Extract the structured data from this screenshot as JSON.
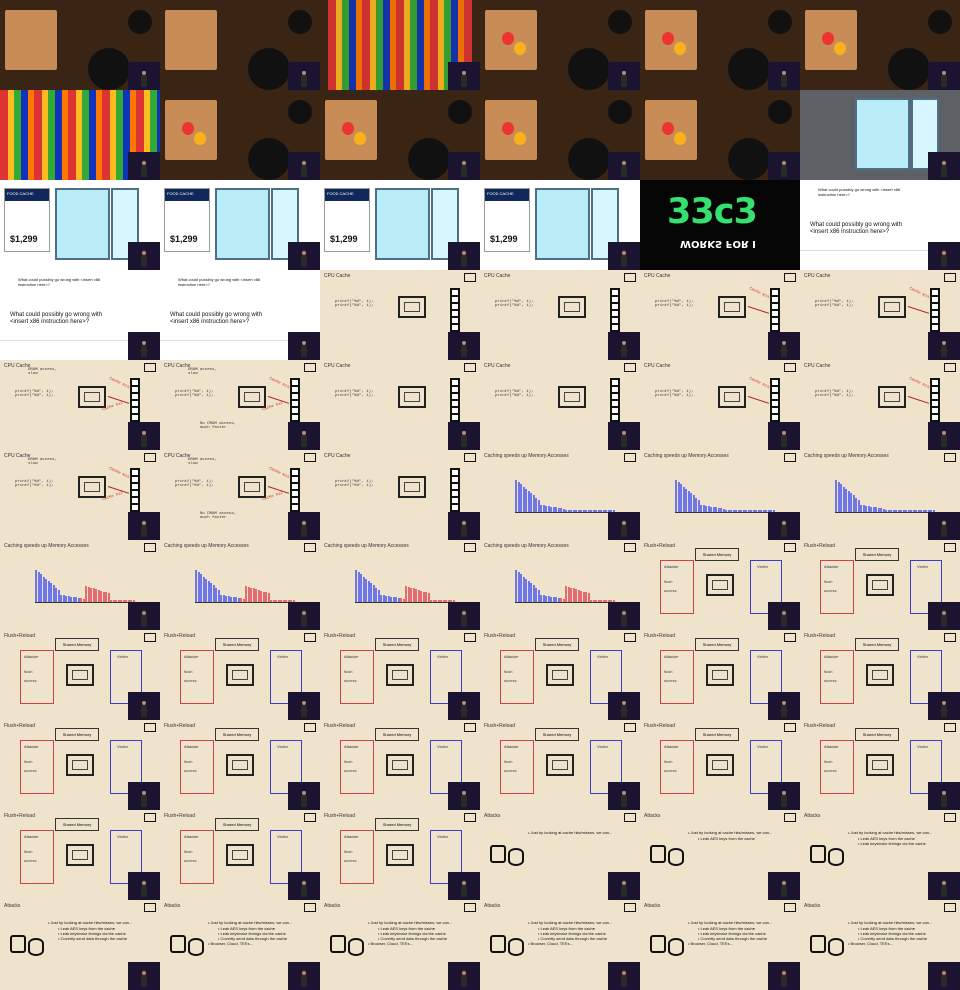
{
  "grid": {
    "columns": 6,
    "rows": 11,
    "frames": [
      {
        "kind": "kitchen",
        "title": ""
      },
      {
        "kind": "kitchen",
        "title": ""
      },
      {
        "kind": "market",
        "title": ""
      },
      {
        "kind": "kitchen",
        "title": ""
      },
      {
        "kind": "kitchen",
        "title": ""
      },
      {
        "kind": "kitchen",
        "title": ""
      },
      {
        "kind": "shelves",
        "title": ""
      },
      {
        "kind": "kitchen",
        "title": ""
      },
      {
        "kind": "kitchen",
        "title": ""
      },
      {
        "kind": "kitchen",
        "title": ""
      },
      {
        "kind": "kitchen",
        "title": ""
      },
      {
        "kind": "fridge",
        "title": ""
      },
      {
        "kind": "fridge_price",
        "title": "FOOD CACHE",
        "price": "$1,299"
      },
      {
        "kind": "fridge_price",
        "title": "FOOD CACHE",
        "price": "$1,299"
      },
      {
        "kind": "fridge_price",
        "title": "FOOD CACHE",
        "price": "$1,299"
      },
      {
        "kind": "fridge_price",
        "title": "FOOD CACHE",
        "price": "$1,299"
      },
      {
        "kind": "congress",
        "title": "33c3",
        "subtitle": "WORKS FOR I"
      },
      {
        "kind": "talk_title",
        "title": "What could possibly go wrong with <insert x86 instruction here>?"
      },
      {
        "kind": "talk_title",
        "title": "What could possibly go wrong with <insert x86 instruction here>?"
      },
      {
        "kind": "talk_title",
        "title": "What could possibly go wrong with <insert x86 instruction here>?"
      },
      {
        "kind": "cache",
        "title": "CPU Cache"
      },
      {
        "kind": "cache",
        "title": "CPU Cache"
      },
      {
        "kind": "cache",
        "title": "CPU Cache"
      },
      {
        "kind": "cache",
        "title": "CPU Cache"
      },
      {
        "kind": "cache",
        "title": "CPU Cache"
      },
      {
        "kind": "cache",
        "title": "CPU Cache"
      },
      {
        "kind": "cache",
        "title": "CPU Cache"
      },
      {
        "kind": "cache",
        "title": "CPU Cache"
      },
      {
        "kind": "cache",
        "title": "CPU Cache"
      },
      {
        "kind": "cache",
        "title": "CPU Cache"
      },
      {
        "kind": "cache",
        "title": "CPU Cache"
      },
      {
        "kind": "cache",
        "title": "CPU Cache"
      },
      {
        "kind": "cache",
        "title": "CPU Cache"
      },
      {
        "kind": "hist",
        "title": "Caching speeds up Memory Accesses"
      },
      {
        "kind": "hist",
        "title": "Caching speeds up Memory Accesses"
      },
      {
        "kind": "hist",
        "title": "Caching speeds up Memory Accesses"
      },
      {
        "kind": "hist2",
        "title": "Caching speeds up Memory Accesses"
      },
      {
        "kind": "hist2",
        "title": "Caching speeds up Memory Accesses"
      },
      {
        "kind": "hist2",
        "title": "Caching speeds up Memory Accesses"
      },
      {
        "kind": "hist2",
        "title": "Caching speeds up Memory Accesses"
      },
      {
        "kind": "flush",
        "title": "Flush+Reload"
      },
      {
        "kind": "flush",
        "title": "Flush+Reload"
      },
      {
        "kind": "flush",
        "title": "Flush+Reload"
      },
      {
        "kind": "flush",
        "title": "Flush+Reload"
      },
      {
        "kind": "flush",
        "title": "Flush+Reload"
      },
      {
        "kind": "flush",
        "title": "Flush+Reload"
      },
      {
        "kind": "flush",
        "title": "Flush+Reload"
      },
      {
        "kind": "flush",
        "title": "Flush+Reload"
      },
      {
        "kind": "flush",
        "title": "Flush+Reload"
      },
      {
        "kind": "flush",
        "title": "Flush+Reload"
      },
      {
        "kind": "flush",
        "title": "Flush+Reload"
      },
      {
        "kind": "flush",
        "title": "Flush+Reload"
      },
      {
        "kind": "flush",
        "title": "Flush+Reload"
      },
      {
        "kind": "flush",
        "title": "Flush+Reload"
      },
      {
        "kind": "flush",
        "title": "Flush+Reload"
      },
      {
        "kind": "flush",
        "title": "Flush+Reload"
      },
      {
        "kind": "flush",
        "title": "Flush+Reload"
      },
      {
        "kind": "attacks",
        "title": "Attacks"
      },
      {
        "kind": "attacks",
        "title": "Attacks"
      },
      {
        "kind": "attacks",
        "title": "Attacks"
      },
      {
        "kind": "attacks",
        "title": "Attacks"
      },
      {
        "kind": "attacks",
        "title": "Attacks"
      },
      {
        "kind": "attacks",
        "title": "Attacks"
      },
      {
        "kind": "attacks",
        "title": "Attacks"
      },
      {
        "kind": "attacks",
        "title": "Attacks"
      },
      {
        "kind": "attacks",
        "title": "Attacks"
      }
    ],
    "labels": {
      "cache_code": "printf(\"%d\", i);\nprintf(\"%d\", i);",
      "cache_miss": "Cache miss",
      "cache_hit": "Cache hit",
      "dram_access": "DRAM access,\nslow",
      "no_dram": "No DRAM access,\nmuch faster",
      "shared_memory": "Shared Memory",
      "attacker": "Attacker",
      "victim": "Victim",
      "flush": "flush",
      "access": "access",
      "bullet_1": "Just by looking at cache hits/misses, we can...",
      "bullet_2": "Leak AES keys from the cache",
      "bullet_3": "Leak keystroke timings via the cache",
      "bullet_4": "Covertly send data through the cache",
      "bullet_5": "Browser, Cloud, TEEs..."
    }
  }
}
